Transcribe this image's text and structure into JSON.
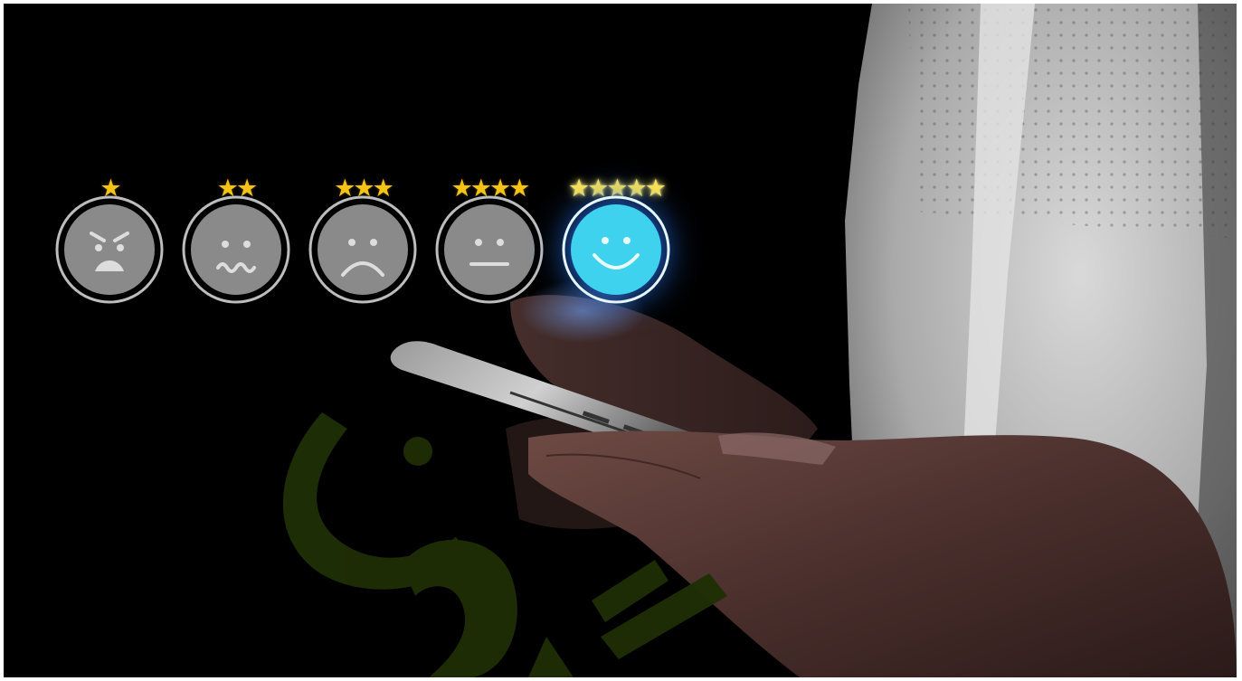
{
  "ratings": [
    {
      "rating": 1,
      "stars": "★",
      "mood": "angry-face-icon",
      "selected": false
    },
    {
      "rating": 2,
      "stars": "★★",
      "mood": "worried-face-icon",
      "selected": false
    },
    {
      "rating": 3,
      "stars": "★★★",
      "mood": "sad-face-icon",
      "selected": false
    },
    {
      "rating": 4,
      "stars": "★★★★",
      "mood": "neutral-face-icon",
      "selected": false
    },
    {
      "rating": 5,
      "stars": "★★★★★",
      "mood": "smiling-face-icon",
      "selected": true
    }
  ],
  "colors": {
    "star": "#f4c313",
    "star_active": "#ffe44d",
    "face_inactive": "#8a8a8a",
    "face_active": "#3fd2ee",
    "ring": "#bdbdbd",
    "background": "#000000",
    "watermark": "#1f2f05"
  },
  "watermark": {
    "text": "نون",
    "style": "logo"
  }
}
